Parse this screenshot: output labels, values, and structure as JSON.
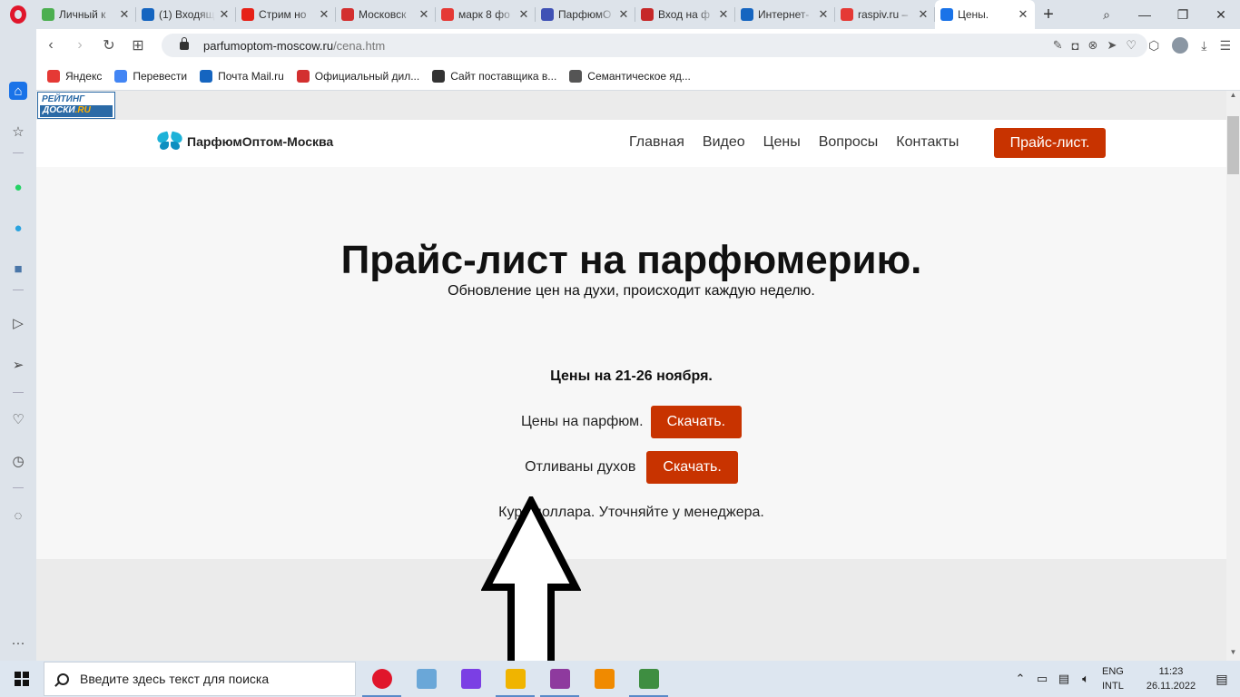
{
  "browser": {
    "tabs": [
      {
        "title": "Личный к",
        "color": "#4caf50"
      },
      {
        "title": "(1) Входящ",
        "color": "#1565c0"
      },
      {
        "title": "Стрим но",
        "color": "#e62117"
      },
      {
        "title": "Московск",
        "color": "#d32f2f"
      },
      {
        "title": "марк 8 фо",
        "color": "#e53935"
      },
      {
        "title": "ПарфюмО",
        "color": "#3f51b5"
      },
      {
        "title": "Вход на ф",
        "color": "#c62828"
      },
      {
        "title": "Интернет-",
        "color": "#1565c0"
      },
      {
        "title": "raspiv.ru –",
        "color": "#e53935"
      },
      {
        "title": "Цены.",
        "color": "#1a73e8",
        "active": true
      }
    ],
    "url_host": "parfumoptom-moscow.ru",
    "url_path": "/cena.htm",
    "bookmarks": [
      {
        "label": "Яндекс",
        "color": "#e53935"
      },
      {
        "label": "Перевести",
        "color": "#4285f4"
      },
      {
        "label": "Почта Mail.ru",
        "color": "#1565c0"
      },
      {
        "label": "Официальный дил...",
        "color": "#d32f2f"
      },
      {
        "label": "Сайт поставщика в...",
        "color": "#333333"
      },
      {
        "label": "Семантическое яд...",
        "color": "#555555"
      }
    ]
  },
  "site": {
    "rating_top": "РЕЙТИНГ",
    "rating_left": "ДОСКИ",
    "rating_right": ".RU",
    "brand": "ПарфюмОптом-Москва",
    "nav": [
      "Главная",
      "Видео",
      "Цены",
      "Вопросы",
      "Контакты"
    ],
    "price_button": "Прайс-лист.",
    "title": "Прайс-лист на парфюмерию.",
    "subtitle": "Обновление цен на духи, происходит каждую неделю.",
    "dates": "Цены на 21-26 ноября.",
    "row1_label": "Цены на парфюм.",
    "row1_button": "Скачать.",
    "row2_label": "Отливаны духов",
    "row2_button": "Скачать.",
    "rate_note": "Курс доллара. Уточняйте у менеджера."
  },
  "taskbar": {
    "search_placeholder": "Введите здесь текст для поиска",
    "apps": [
      {
        "name": "opera",
        "color": "#e0162b",
        "running": true
      },
      {
        "name": "notepad",
        "color": "#6aa7d8",
        "running": false
      },
      {
        "name": "paint-drop",
        "color": "#7b3fe4",
        "running": false
      },
      {
        "name": "file-manager",
        "color": "#f0b400",
        "running": true
      },
      {
        "name": "winrar",
        "color": "#8e3a9e",
        "running": true
      },
      {
        "name": "vlc",
        "color": "#f08a00",
        "running": false
      },
      {
        "name": "calculator-app",
        "color": "#3e8e41",
        "running": true
      }
    ],
    "lang_top": "ENG",
    "lang_bottom": "INTL",
    "time": "11:23",
    "date": "26.11.2022"
  }
}
